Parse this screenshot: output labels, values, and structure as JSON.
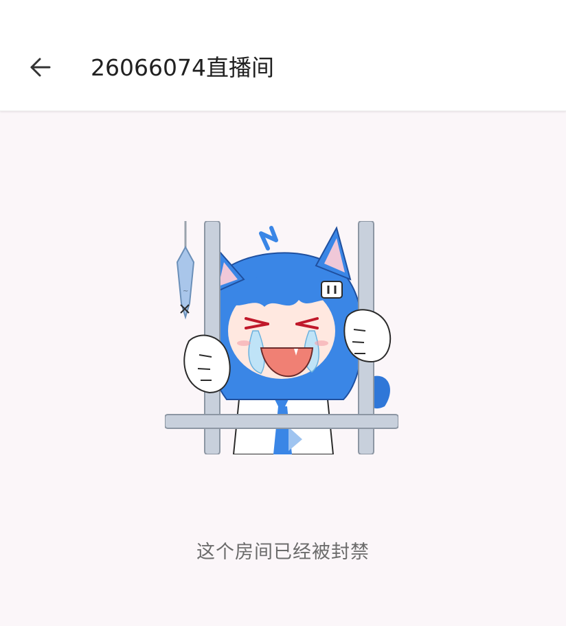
{
  "header": {
    "back_icon": "arrow-left-icon",
    "title": "26066074直播间"
  },
  "content": {
    "illustration": "crying-mascot-in-jail",
    "message": "这个房间已经被封禁"
  },
  "colors": {
    "background": "#fbf6f9",
    "header": "#ffffff",
    "title_text": "#202020",
    "message_text": "#6b6b6b",
    "mascot_hair": "#3a86e6",
    "bars": "#c8d0dc"
  }
}
